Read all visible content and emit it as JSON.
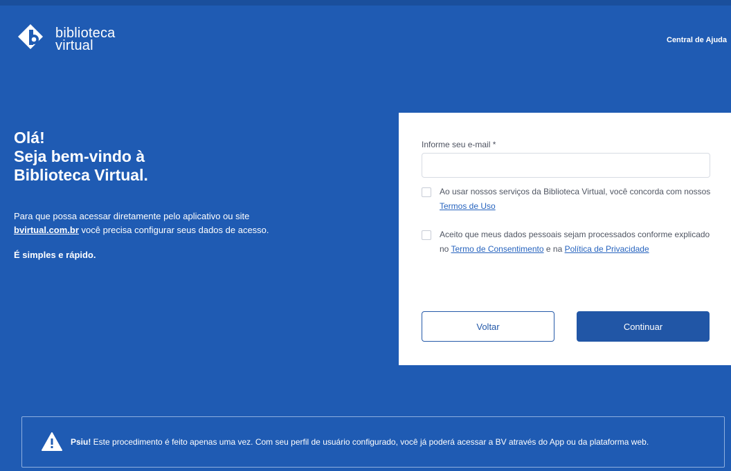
{
  "header": {
    "logo_line1": "biblioteca",
    "logo_line2": "virtual",
    "help_link": "Central de Ajuda"
  },
  "hero": {
    "greeting": "Olá!",
    "welcome_line1": "Seja bem-vindo à",
    "welcome_line2": "Biblioteca Virtual.",
    "intro_line1": "Para que possa acessar diretamente pelo aplicativo ou site",
    "site": "bvirtual.com.br",
    "intro_line2_rest": " você precisa configurar seus dados de acesso.",
    "simple": "É simples e rápido."
  },
  "form": {
    "email_label": "Informe seu e-mail *",
    "email_value": "",
    "email_placeholder": "",
    "terms_text": "Ao usar nossos serviços da Biblioteca Virtual, você concorda com nossos ",
    "terms_link": "Termos de Uso",
    "consent_text_1": "Aceito que meus dados pessoais sejam processados conforme explicado no ",
    "consent_link_1": "Termo de Consentimento",
    "consent_text_2": " e na ",
    "consent_link_2": "Política de Privacidade",
    "back_button": "Voltar",
    "continue_button": "Continuar"
  },
  "notice": {
    "bold": "Psiu!",
    "text": " Este procedimento é feito apenas uma vez. Com seu perfil de usuário configurado, você já poderá acessar a BV através do App ou da plataforma web."
  },
  "colors": {
    "background": "#1f5bb3",
    "primary_button": "#2156a6",
    "link": "#2663be"
  },
  "icons": {
    "logo": "biblioteca-virtual-logo",
    "warning": "warning-triangle-icon"
  }
}
